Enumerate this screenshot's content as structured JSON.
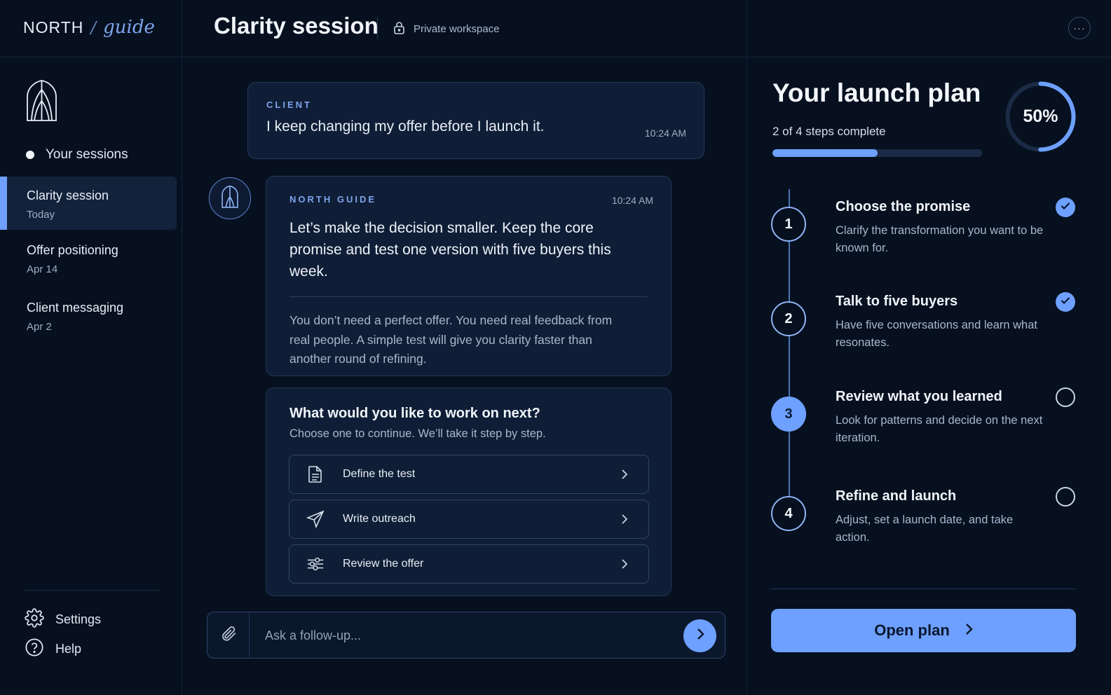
{
  "brand": {
    "name": "NORTH",
    "slash": "/",
    "sub": "guide"
  },
  "header": {
    "title": "Clarity session",
    "workspace": "Private workspace",
    "more_label": "···"
  },
  "sidebar": {
    "sessions_heading": "Your sessions",
    "sessions": [
      {
        "title": "Clarity session",
        "date": "Today"
      },
      {
        "title": "Offer positioning",
        "date": "Apr 14"
      },
      {
        "title": "Client messaging",
        "date": "Apr 2"
      }
    ],
    "settings_label": "Settings",
    "help_label": "Help"
  },
  "chat": {
    "client": {
      "label": "CLIENT",
      "text": "I keep changing my offer before I launch it.",
      "time": "10:24 AM"
    },
    "guide": {
      "label": "NORTH GUIDE",
      "time": "10:24 AM",
      "main": "Let’s make the decision smaller. Keep the core promise and test one version with five buyers this week.",
      "note": "You don’t need a perfect offer. You need real feedback from real people. A simple test will give you clarity faster than another round of refining."
    },
    "options": {
      "title": "What would you like to work on next?",
      "subtitle": "Choose one to continue. We’ll take it step by step.",
      "items": [
        {
          "label": "Define the test",
          "icon": "document-icon"
        },
        {
          "label": "Write outreach",
          "icon": "send-icon"
        },
        {
          "label": "Review the offer",
          "icon": "sliders-icon"
        }
      ]
    },
    "composer": {
      "placeholder": "Ask a follow-up..."
    }
  },
  "plan": {
    "title": "Your launch plan",
    "progress_text": "2 of 4 steps complete",
    "percent_label": "50%",
    "progress": 0.5,
    "steps": [
      {
        "num": "1",
        "title": "Choose the promise",
        "desc": "Clarify the transformation you want to be known for.",
        "status": "done"
      },
      {
        "num": "2",
        "title": "Talk to five buyers",
        "desc": "Have five conversations and learn what resonates.",
        "status": "done"
      },
      {
        "num": "3",
        "title": "Review what you learned",
        "desc": "Look for patterns and decide on the next iteration.",
        "status": "current"
      },
      {
        "num": "4",
        "title": "Refine and launch",
        "desc": "Adjust, set a launch date, and take action.",
        "status": "todo"
      }
    ],
    "open_label": "Open plan"
  },
  "colors": {
    "accent": "#6ea0ff",
    "background": "#06101f",
    "card": "#0f1e36"
  }
}
